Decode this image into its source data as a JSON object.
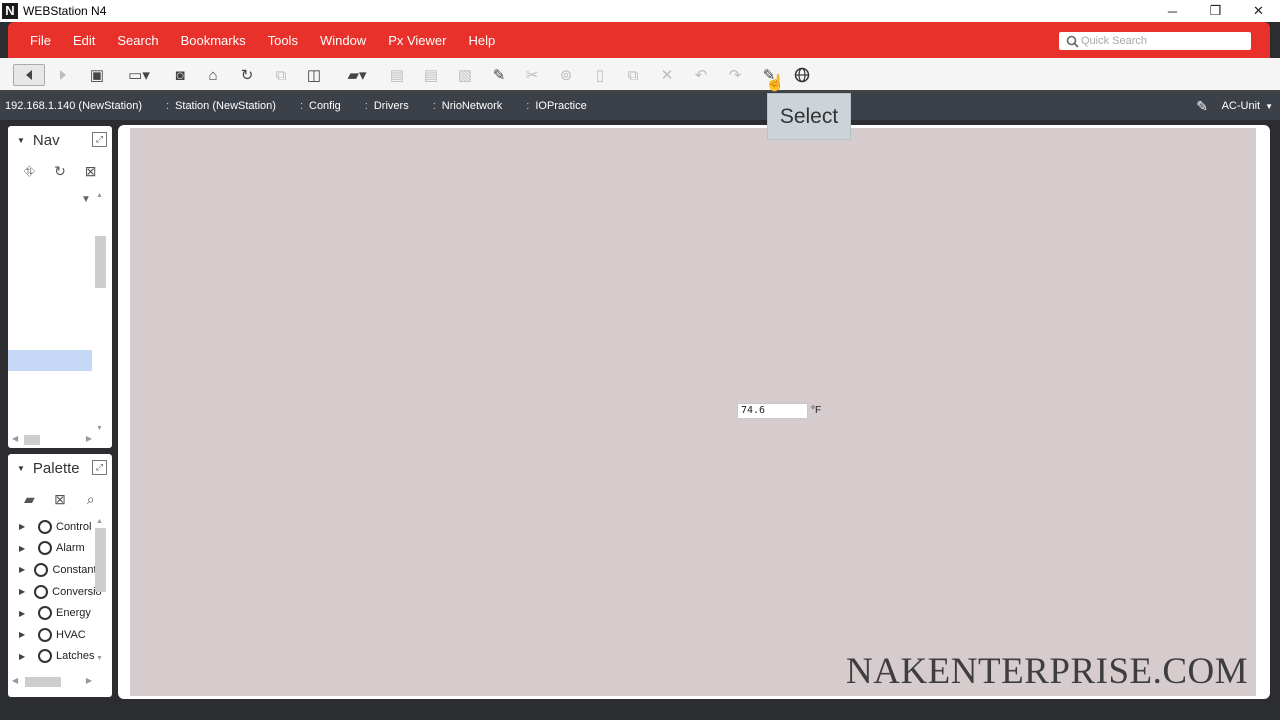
{
  "window": {
    "title": "WEBStation N4",
    "logo_letter": "N",
    "controls": {
      "minimize": "─",
      "restore": "❐",
      "close": "✕"
    }
  },
  "menu": {
    "items": [
      "File",
      "Edit",
      "Search",
      "Bookmarks",
      "Tools",
      "Window",
      "Px Viewer",
      "Help"
    ],
    "quick_search_placeholder": "Quick Search"
  },
  "breadcrumb": {
    "separator": ":",
    "items": [
      "192.168.1.140 (NewStation)",
      "Station (NewStation)",
      "Config",
      "Drivers",
      "NrioNetwork",
      "IOPractice"
    ],
    "view_selector": "AC-Unit"
  },
  "tooltip": {
    "text": "Select"
  },
  "nav_panel": {
    "title": "Nav"
  },
  "palette_panel": {
    "title": "Palette",
    "items": [
      "Control",
      "Alarm",
      "Constants",
      "Conversion",
      "Energy",
      "HVAC",
      "Latches"
    ]
  },
  "canvas": {
    "value": "74.6",
    "unit": "°F"
  },
  "watermark": "NAKENTERPRISE.COM",
  "colors": {
    "menu_bar": "#e8312a",
    "breadcrumb_bar": "#3c4048",
    "canvas_bg": "#d6cccd",
    "nav_selection": "#c5d9f7"
  }
}
